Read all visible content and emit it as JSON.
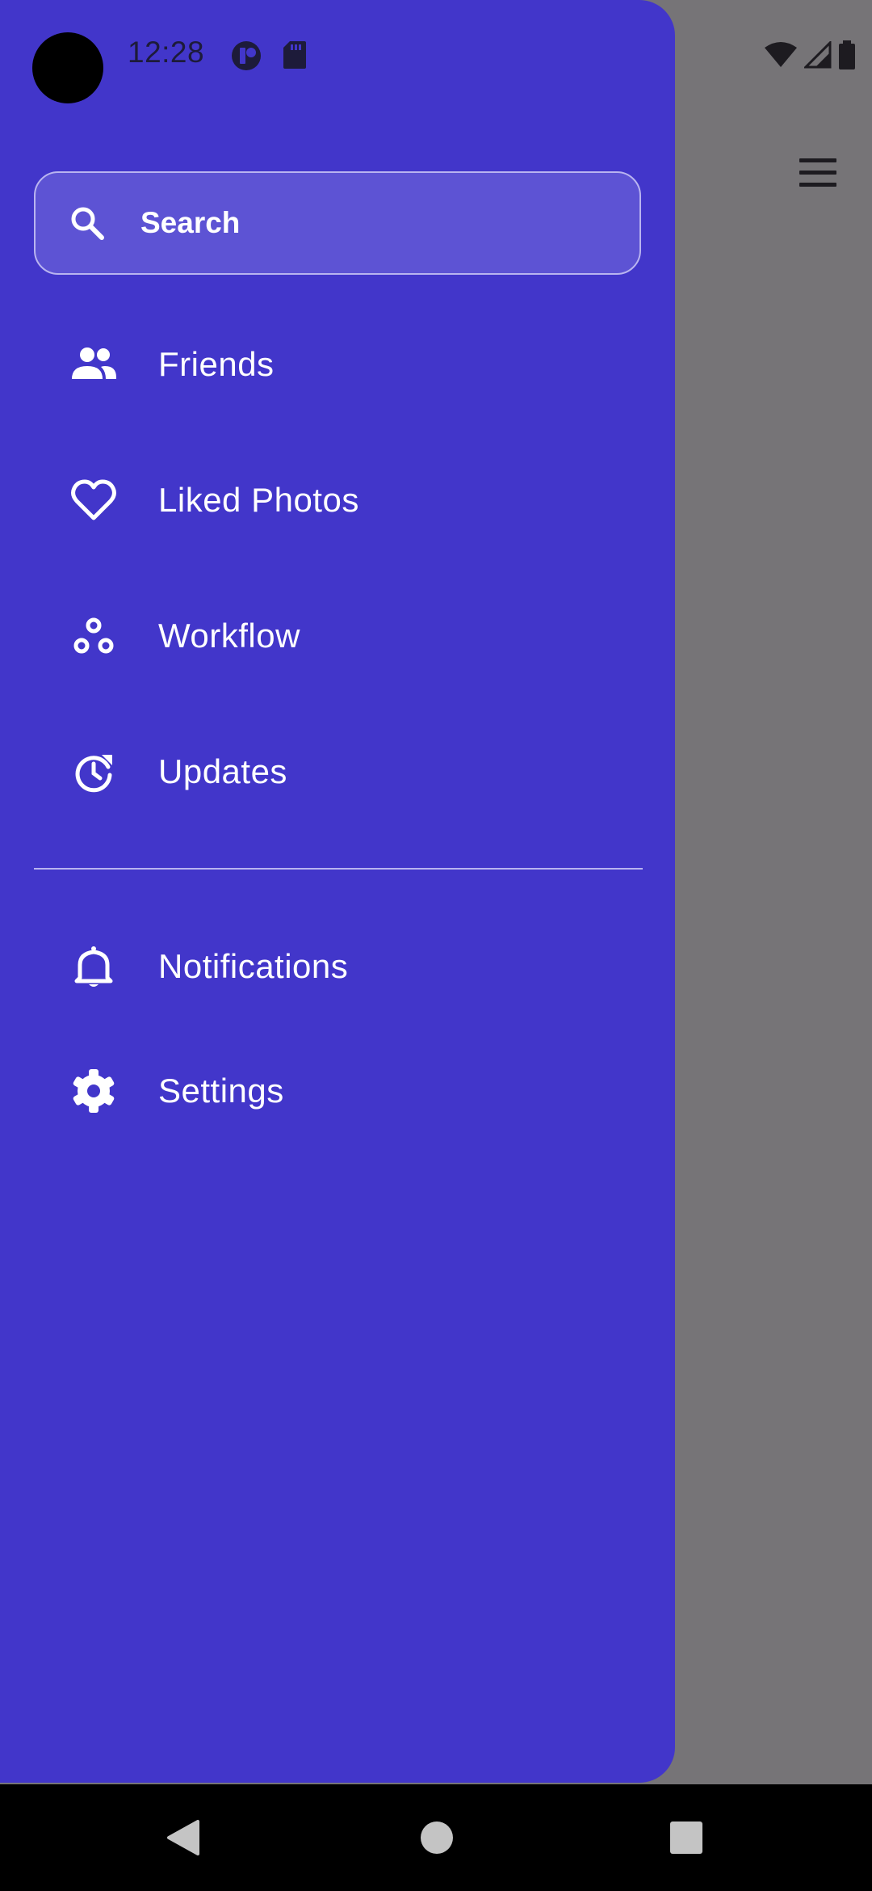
{
  "status_bar": {
    "time": "12:28",
    "icons": [
      "app-notification-icon",
      "sd-card-icon",
      "wifi-icon",
      "signal-icon",
      "battery-icon"
    ]
  },
  "drawer": {
    "background_color": "#4236ca",
    "search": {
      "placeholder": "Search",
      "icon": "search-icon"
    },
    "items": [
      {
        "id": "friends",
        "label": "Friends",
        "icon": "people-icon"
      },
      {
        "id": "liked-photos",
        "label": "Liked Photos",
        "icon": "heart-icon"
      },
      {
        "id": "workflow",
        "label": "Workflow",
        "icon": "workflow-icon"
      },
      {
        "id": "updates",
        "label": "Updates",
        "icon": "update-icon"
      }
    ],
    "secondary_items": [
      {
        "id": "notifications",
        "label": "Notifications",
        "icon": "bell-icon"
      },
      {
        "id": "settings",
        "label": "Settings",
        "icon": "gear-icon"
      }
    ]
  },
  "app_bar": {
    "menu_icon": "menu-icon"
  },
  "navigation_bar": {
    "buttons": [
      "back-icon",
      "home-icon",
      "recents-icon"
    ]
  }
}
